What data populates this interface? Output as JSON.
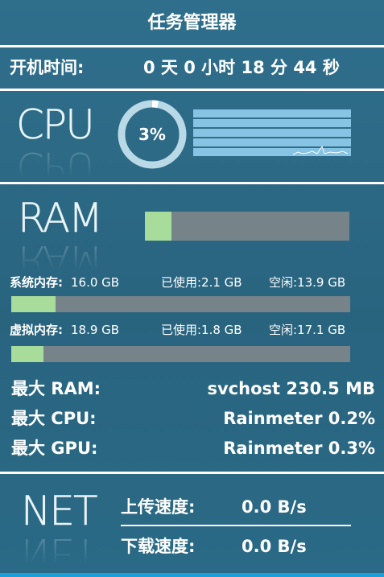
{
  "title": "任务管理器",
  "uptime": {
    "label": "开机时间:",
    "value": "0 天 0 小时 18 分 44 秒"
  },
  "cpu": {
    "heading": "CPU",
    "percent_label": "3%",
    "percent": 0.03
  },
  "ram": {
    "heading": "RAM",
    "usage_fraction": 0.13,
    "physical": {
      "label": "系统内存:",
      "total": "16.0 GB",
      "used": "已使用:2.1 GB",
      "free": "空闲:13.9 GB",
      "usage_fraction": 0.13
    },
    "virtual": {
      "label": "虚拟内存:",
      "total": "18.9 GB",
      "used": "已使用:1.8 GB",
      "free": "空闲:17.1 GB",
      "usage_fraction": 0.095
    }
  },
  "top": [
    {
      "key": "最大 RAM:",
      "value": "svchost 230.5 MB"
    },
    {
      "key": "最大 CPU:",
      "value": "Rainmeter 0.2%"
    },
    {
      "key": "最大 GPU:",
      "value": "Rainmeter 0.3%"
    }
  ],
  "net": {
    "heading": "NET",
    "upload": {
      "label": "上传速度:",
      "value": "0.0 B/s"
    },
    "download": {
      "label": "下载速度:",
      "value": "0.0 B/s"
    }
  },
  "colors": {
    "background": "#2f6d8a",
    "accent_fill": "#a8dc9b",
    "bar_track": "#768389",
    "graph_bg": "#87c3e2"
  }
}
